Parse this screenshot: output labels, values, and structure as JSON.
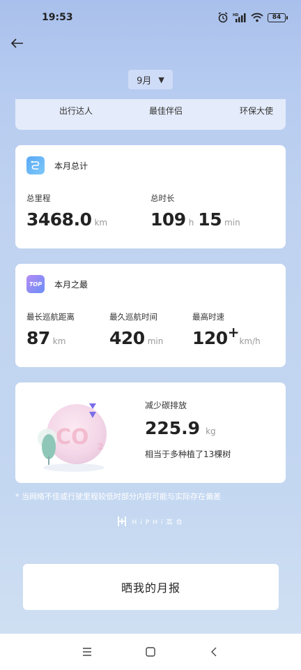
{
  "status_bar": {
    "time": "19:53",
    "battery": "84",
    "icons": [
      "alarm-icon",
      "signal-icon",
      "wifi-icon",
      "battery-icon"
    ]
  },
  "header": {
    "month": "9月",
    "month_arrow": "▼"
  },
  "badges": [
    "出行达人",
    "最佳伴侣",
    "环保大使"
  ],
  "monthly_total": {
    "title": "本月总计",
    "distance_label": "总里程",
    "distance_value": "3468.0",
    "distance_unit": "km",
    "duration_label": "总时长",
    "hours": "109",
    "hours_unit": "h",
    "minutes": "15",
    "minutes_unit": "min"
  },
  "monthly_best": {
    "title": "本月之最",
    "icon_text": "TOP",
    "longest_distance_label": "最长巡航距离",
    "longest_distance_value": "87",
    "longest_distance_unit": "km",
    "longest_time_label": "最久巡航时间",
    "longest_time_value": "420",
    "longest_time_unit": "min",
    "top_speed_label": "最高时速",
    "top_speed_value": "120",
    "top_speed_plus": "+",
    "top_speed_unit": "km/h"
  },
  "carbon": {
    "title": "减少碳排放",
    "value": "225.9",
    "unit": "kg",
    "equivalent": "相当于多种植了13棵树",
    "illustration_text": "CO₂"
  },
  "footnote": "* 当网络不佳或行驶里程较低时部分内容可能与实际存在偏差",
  "brand": "HiPHi高合",
  "share_button": "晒我的月报",
  "colors": {
    "accent": "#3d7ee8",
    "background": "#bfd2f0"
  }
}
